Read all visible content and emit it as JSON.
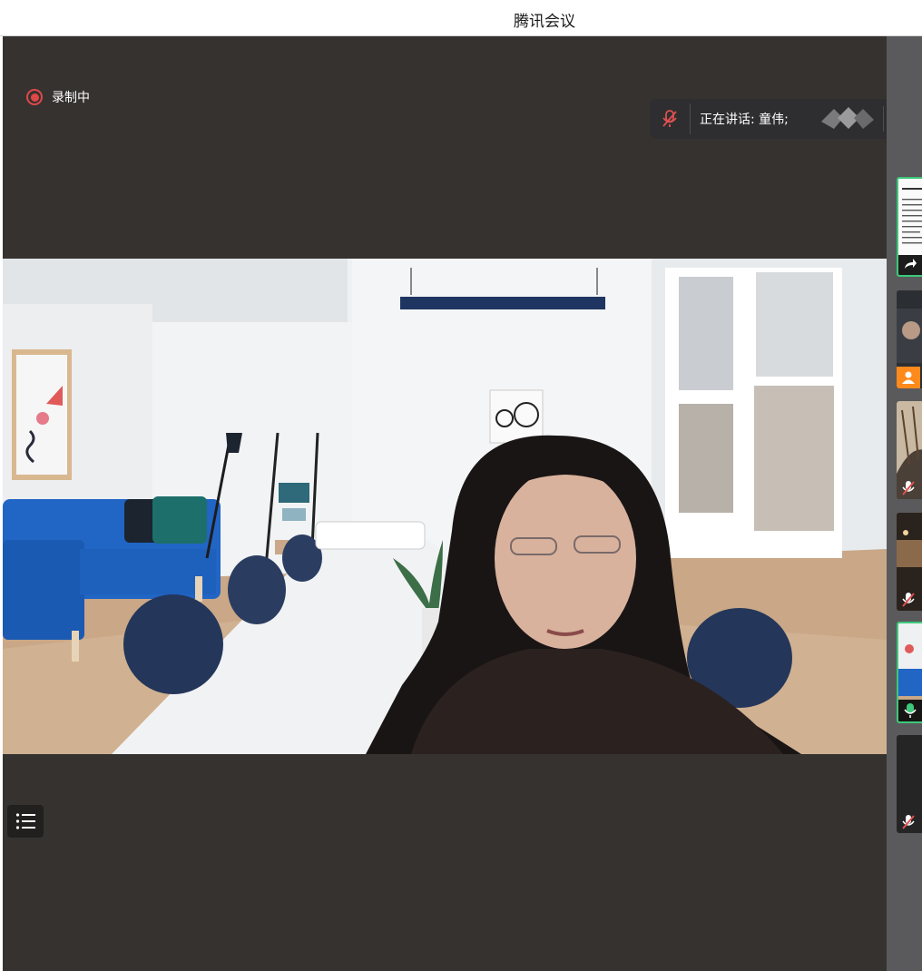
{
  "window": {
    "title": "腾讯会议"
  },
  "recording": {
    "label": "录制中"
  },
  "speaking": {
    "label": "正在讲话: 童伟;"
  },
  "main_video": {
    "participant_name": "童伟"
  },
  "participants": [
    {
      "kind": "screen-share",
      "status": "sharing"
    },
    {
      "kind": "camera",
      "status": "avatar"
    },
    {
      "kind": "camera",
      "status": "muted"
    },
    {
      "kind": "camera",
      "status": "muted"
    },
    {
      "kind": "camera",
      "status": "speaking"
    },
    {
      "kind": "camera",
      "status": "muted"
    }
  ],
  "icons": {
    "recording": "record-icon",
    "speaking_mic": "mic-muted-icon",
    "brand": "tencent-meeting-logo-icon",
    "back": "reply-icon",
    "list": "list-icon",
    "name_mic": "mic-icon"
  },
  "colors": {
    "stage": "#363230",
    "sidebar": "#5a5a5c",
    "active": "#3cc97a",
    "record": "#e04848",
    "mic_on": "#3cc97a",
    "mute": "#e05050"
  }
}
